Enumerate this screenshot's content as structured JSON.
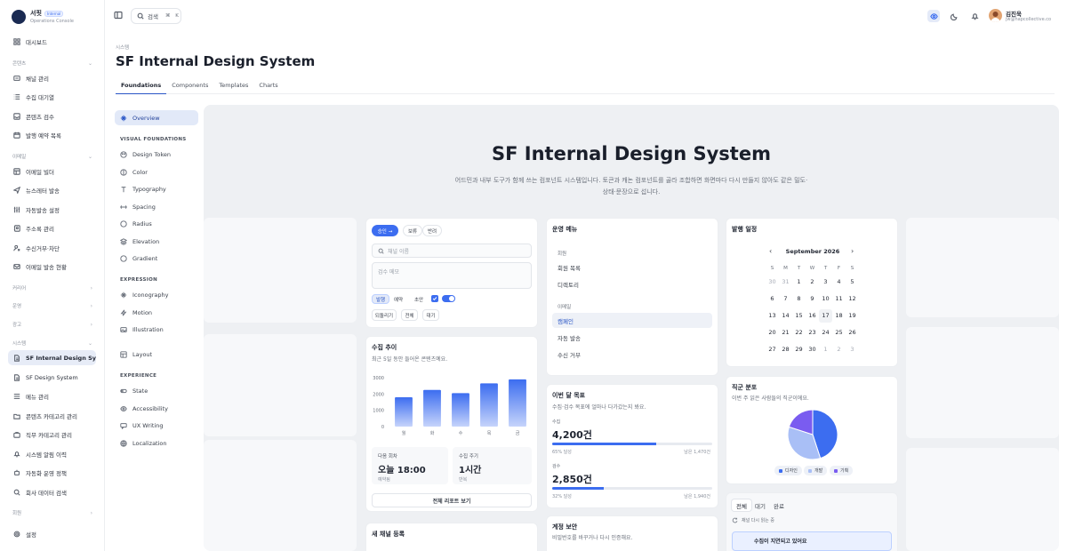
{
  "brand": {
    "name": "서핏",
    "badge": "Internal",
    "subtitle": "Operations Console"
  },
  "sidebar": {
    "dashboard": "대시보드",
    "groups": {
      "content": "콘텐츠",
      "email": "이메일",
      "career": "커리어",
      "ops": "운영",
      "ads": "광고",
      "system": "시스템",
      "member": "회원"
    },
    "content_items": [
      "채널 관리",
      "수집 대기열",
      "콘텐츠 검수",
      "발행 예약 목록"
    ],
    "email_items": [
      "이메일 빌더",
      "뉴스레터 발송",
      "자동발송 설정",
      "주소록 관리",
      "수신거부·차단",
      "이메일 발송 현황"
    ],
    "system_items": [
      "SF Internal Design System",
      "SF Design System",
      "메뉴 관리",
      "콘텐츠 카테고리 관리",
      "직무 카테고리 관리",
      "시스템 알림 이력",
      "자동화 운영 정책",
      "회사 데이터 검색"
    ],
    "settings": "설정"
  },
  "topbar": {
    "search_label": "검색",
    "shortcut": "⌘ K",
    "user_name": "김진욱",
    "user_email": "jw@hapcollective.co"
  },
  "page": {
    "breadcrumb": "시스템",
    "title": "SF Internal Design System",
    "tabs": [
      "Foundations",
      "Components",
      "Templates",
      "Charts"
    ]
  },
  "docnav": {
    "overview": "Overview",
    "sections": [
      {
        "head": "VISUAL FOUNDATIONS",
        "items": [
          "Design Token",
          "Color",
          "Typography",
          "Spacing",
          "Radius",
          "Elevation",
          "Gradient"
        ]
      },
      {
        "head": "EXPRESSION",
        "items": [
          "Iconography",
          "Motion",
          "Illustration"
        ]
      },
      {
        "head": "",
        "items": [
          "Layout"
        ]
      },
      {
        "head": "EXPERIENCE",
        "items": [
          "State",
          "Accessibility",
          "UX Writing",
          "Localization"
        ]
      }
    ]
  },
  "hero": {
    "title": "SF Internal Design System",
    "desc": "어드민과 내부 도구가 함께 쓰는 컴포넌트 시스템입니다. 토큰과 캐논 컴포넌트를 골라 조합하면 화면마다 다시 만들지 않아도 같은 밀도·상태·문장으로 섭니다."
  },
  "form_card": {
    "pills": [
      "승인 →",
      "보류",
      "반려"
    ],
    "channel_placeholder": "채널 이름",
    "memo_placeholder": "검수 메모",
    "segments": [
      "발행",
      "예약",
      "초안"
    ],
    "buttons": [
      "되돌리기",
      "전체",
      "대기"
    ]
  },
  "trend_card": {
    "title": "수집 추이",
    "subtitle": "최근 5일 동안 들어온 콘텐츠예요.",
    "next_label": "다음 회차",
    "next_value": "오늘 18:00",
    "next_note": "예약됨",
    "cycle_label": "수집 주기",
    "cycle_value": "1시간",
    "cycle_note": "반복",
    "report_button": "전체 리포트 보기"
  },
  "chart_data": {
    "type": "bar",
    "categories": [
      "월",
      "화",
      "수",
      "목",
      "금"
    ],
    "values": [
      1800,
      2250,
      2050,
      2650,
      2900
    ],
    "yticks": [
      0,
      1000,
      2000,
      3000
    ],
    "ylim": [
      0,
      3000
    ]
  },
  "menu_card": {
    "title": "운영 메뉴",
    "groups": [
      {
        "label": "회원",
        "items": [
          "회원 목록",
          "디렉토리"
        ]
      },
      {
        "label": "이메일",
        "items": [
          "캠페인",
          "자동 발송",
          "수신 거부"
        ]
      }
    ],
    "active": "캠페인"
  },
  "goal_card": {
    "title": "이번 달 목표",
    "subtitle": "수집·검수 목표에 얼마나 다가갔는지 봐요.",
    "items": [
      {
        "label": "수집",
        "value": "4,200건",
        "progress": 0.65,
        "pct_text": "65% 달성",
        "remain": "남은 1,470건"
      },
      {
        "label": "검수",
        "value": "2,850건",
        "progress": 0.32,
        "pct_text": "32% 달성",
        "remain": "남은 1,940건"
      }
    ]
  },
  "security_card": {
    "title": "계정 보안",
    "subtitle": "비밀번호를 바꾸거나 다시 인증해요."
  },
  "new_channel_card": {
    "title": "새 채널 등록"
  },
  "calendar_card": {
    "title": "발행 일정",
    "month": "September 2026",
    "dow": [
      "S",
      "M",
      "T",
      "W",
      "T",
      "F",
      "S"
    ],
    "weeks": [
      [
        "30",
        "31",
        "1",
        "2",
        "3",
        "4",
        "5"
      ],
      [
        "6",
        "7",
        "8",
        "9",
        "10",
        "11",
        "12"
      ],
      [
        "13",
        "14",
        "15",
        "16",
        "17",
        "18",
        "19"
      ],
      [
        "20",
        "21",
        "22",
        "23",
        "24",
        "25",
        "26"
      ],
      [
        "27",
        "28",
        "29",
        "30",
        "1",
        "2",
        "3"
      ]
    ],
    "today": "17"
  },
  "pie_card": {
    "title": "직군 분포",
    "subtitle": "이번 주 읽은 사람들의 직군이에요.",
    "slices": [
      {
        "name": "디자인",
        "value": 45,
        "color": "#3c6df0"
      },
      {
        "name": "개발",
        "value": 35,
        "color": "#a9bff6"
      },
      {
        "name": "기획",
        "value": 20,
        "color": "#7a5cf0"
      }
    ]
  },
  "tasks_card": {
    "tabs": [
      "전체",
      "대기",
      "완료"
    ],
    "status": "채널 다시 읽는 중",
    "alert": "수집이 지연되고 있어요"
  },
  "colors": {
    "accent": "#3c6df0",
    "accent_light": "#e4eaf8"
  }
}
